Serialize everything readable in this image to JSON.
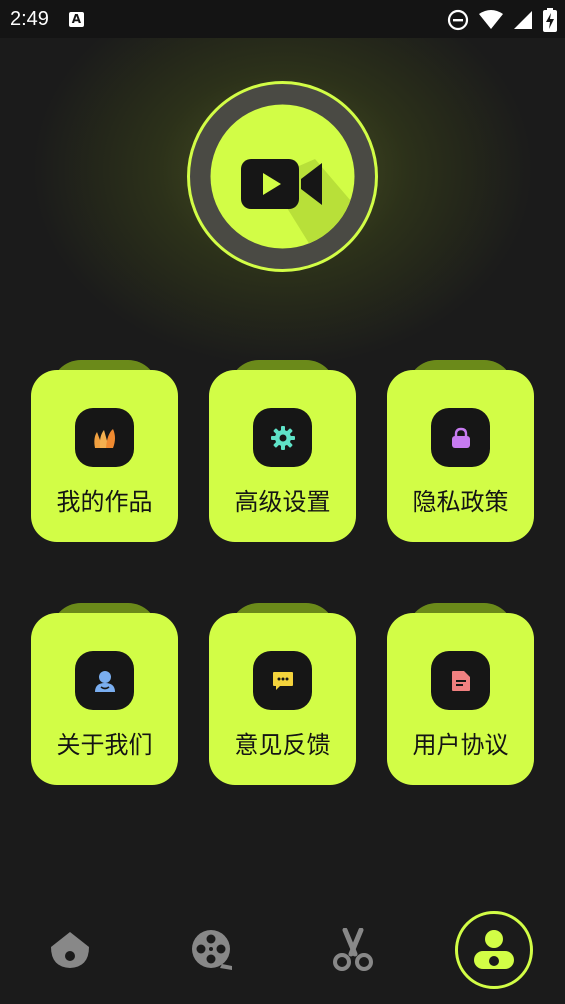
{
  "status_bar": {
    "time": "2:49",
    "left_icon": "A",
    "icons": [
      "do-not-disturb-icon",
      "wifi-icon",
      "signal-icon",
      "battery-charging-icon"
    ]
  },
  "logo": {
    "icon": "video-camera-icon"
  },
  "colors": {
    "accent": "#d2fd46",
    "background": "#1b1b1b",
    "icon_tile": "#161616"
  },
  "menu": [
    {
      "label": "我的作品",
      "icon": "fan-cards-icon"
    },
    {
      "label": "高级设置",
      "icon": "gear-icon"
    },
    {
      "label": "隐私政策",
      "icon": "lock-icon"
    },
    {
      "label": "关于我们",
      "icon": "user-icon"
    },
    {
      "label": "意见反馈",
      "icon": "chat-bubble-icon"
    },
    {
      "label": "用户协议",
      "icon": "document-icon"
    }
  ],
  "bottom_nav": [
    {
      "icon": "home-icon",
      "active": false
    },
    {
      "icon": "film-reel-icon",
      "active": false
    },
    {
      "icon": "scissors-icon",
      "active": false
    },
    {
      "icon": "profile-icon",
      "active": true
    }
  ]
}
